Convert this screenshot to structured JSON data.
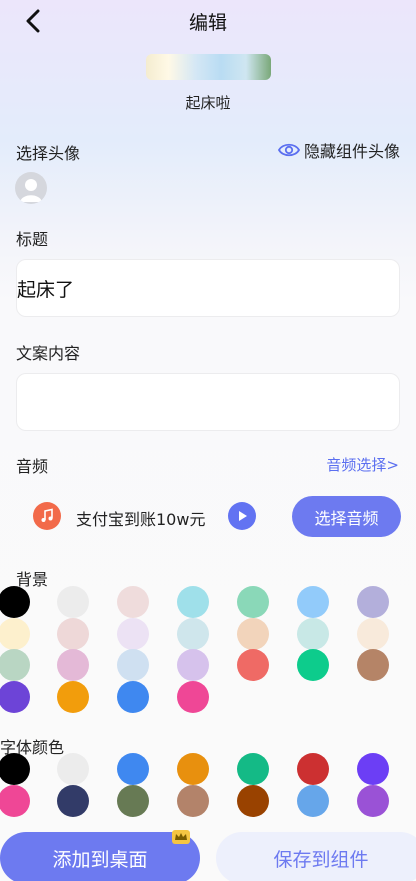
{
  "header": {
    "title": "编辑"
  },
  "preview": {
    "caption": "起床啦"
  },
  "avatar_section": {
    "label": "选择头像",
    "hide_label": "隐藏组件头像"
  },
  "title_section": {
    "label": "标题",
    "value": "起床了"
  },
  "content_section": {
    "label": "文案内容",
    "value": "",
    "placeholder": ""
  },
  "audio_section": {
    "label": "音频",
    "select_link": "音频选择>",
    "track_name": "支付宝到账10w元",
    "pick_button": "选择音频",
    "accent_color": "#6d7af0",
    "music_icon_color": "#f26a4a"
  },
  "background_section": {
    "label": "背景",
    "colors": [
      [
        "#000000",
        "#ececec",
        "#efdcdc",
        "#9fe0ea",
        "#8ad8b8",
        "#92cbfa",
        "#b3afdb"
      ],
      [
        "#fdf0cd",
        "#eed8d8",
        "#ece2f4",
        "#cfe6ec",
        "#f2d4bb",
        "#c8e8e6",
        "#f8eadb"
      ],
      [
        "#b9d6c3",
        "#e4b9d7",
        "#cfe0f1",
        "#d6c2ec",
        "#ef6a65",
        "#0dcc8c",
        "#b58467"
      ],
      [
        "#6d44d7",
        "#f29d0c",
        "#3f88f0",
        "#ef4796"
      ]
    ]
  },
  "font_color_section": {
    "label": "字体颜色",
    "colors": [
      [
        "#000000",
        "#ececec",
        "#3f88f0",
        "#e8900e",
        "#14ba86",
        "#cc3031",
        "#6c3ef5"
      ],
      [
        "#ef4796",
        "#323b68",
        "#677a54",
        "#b3836a",
        "#994200",
        "#66a6ea",
        "#9a52d6"
      ]
    ]
  },
  "actions": {
    "add_to_desktop": "添加到桌面",
    "save_to_widget": "保存到组件"
  }
}
